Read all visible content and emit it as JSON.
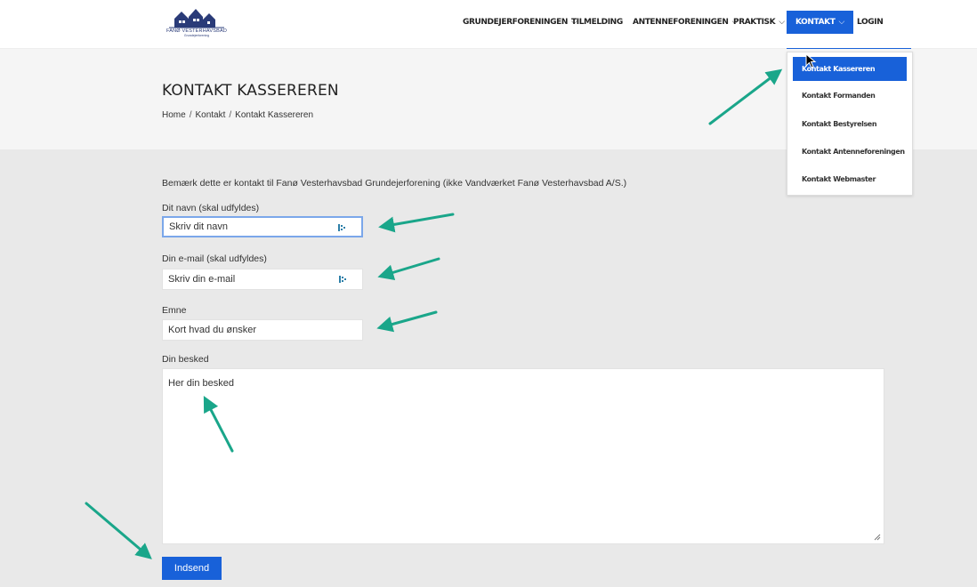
{
  "header": {
    "logo_text": "FANØ VESTERHAVSBAD",
    "logo_sub": "Grundejerforening",
    "nav": [
      {
        "label": "GRUNDEJERFORENINGEN",
        "has_chevron": true
      },
      {
        "label": "TILMELDING",
        "has_chevron": false
      },
      {
        "label": "ANTENNEFORENINGEN",
        "has_chevron": true
      },
      {
        "label": "PRAKTISK",
        "has_chevron": true
      },
      {
        "label": "KONTAKT",
        "has_chevron": true,
        "active": true
      },
      {
        "label": "LOGIN",
        "has_chevron": false
      }
    ],
    "chevron_icon": "chevron-down-icon",
    "accent_color": "#1861d9"
  },
  "dropdown": {
    "items": [
      {
        "label": "Kontakt Kassereren",
        "active": true
      },
      {
        "label": "Kontakt Formanden"
      },
      {
        "label": "Kontakt Bestyrelsen"
      },
      {
        "label": "Kontakt Antenneforeningen"
      },
      {
        "label": "Kontakt Webmaster"
      }
    ]
  },
  "hero": {
    "title": "KONTAKT KASSEREREN",
    "breadcrumb": [
      "Home",
      "Kontakt",
      "Kontakt Kassereren"
    ],
    "breadcrumb_separator": "/"
  },
  "form": {
    "notice": "Bemærk dette er kontakt til Fanø Vesterhavsbad Grundejerforening (ikke Vandværket Fanø Vesterhavsbad A/S.)",
    "name_label": "Dit navn (skal udfyldes)",
    "name_value": "Skriv dit navn",
    "email_label": "Din e-mail (skal udfyldes)",
    "email_value": "Skriv din e-mail",
    "subject_label": "Emne",
    "subject_value": "Kort hvad du ønsker",
    "message_label": "Din besked",
    "message_value": "Her din besked",
    "submit_label": "Indsend"
  },
  "annotation": {
    "arrow_color": "#1aa68a"
  }
}
